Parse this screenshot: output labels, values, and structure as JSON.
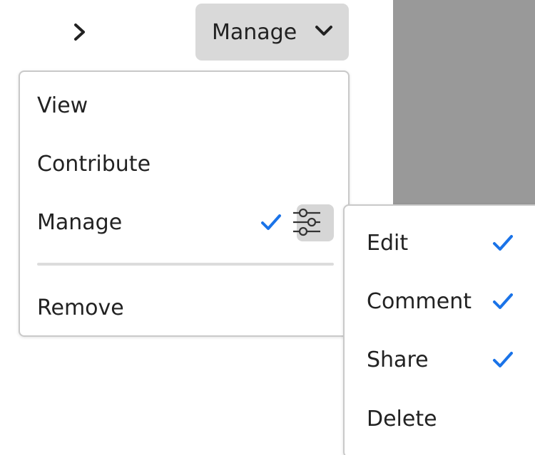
{
  "toolbar": {
    "expand_icon": "chevron-right-icon",
    "role_picker_label": "Manage",
    "role_picker_icon": "chevron-down-icon"
  },
  "role_menu": {
    "items": [
      {
        "label": "View",
        "selected": false
      },
      {
        "label": "Contribute",
        "selected": false
      },
      {
        "label": "Manage",
        "selected": true
      },
      {
        "label": "Remove",
        "selected": false
      }
    ],
    "settings_icon": "sliders-icon"
  },
  "permissions_menu": {
    "items": [
      {
        "label": "Edit",
        "checked": true
      },
      {
        "label": "Comment",
        "checked": true
      },
      {
        "label": "Share",
        "checked": true
      },
      {
        "label": "Delete",
        "checked": false
      }
    ]
  },
  "colors": {
    "accent": "#1a73e8",
    "picker_bg": "#d9d9d9",
    "backdrop": "#999999",
    "divider": "#dcdcdc"
  }
}
